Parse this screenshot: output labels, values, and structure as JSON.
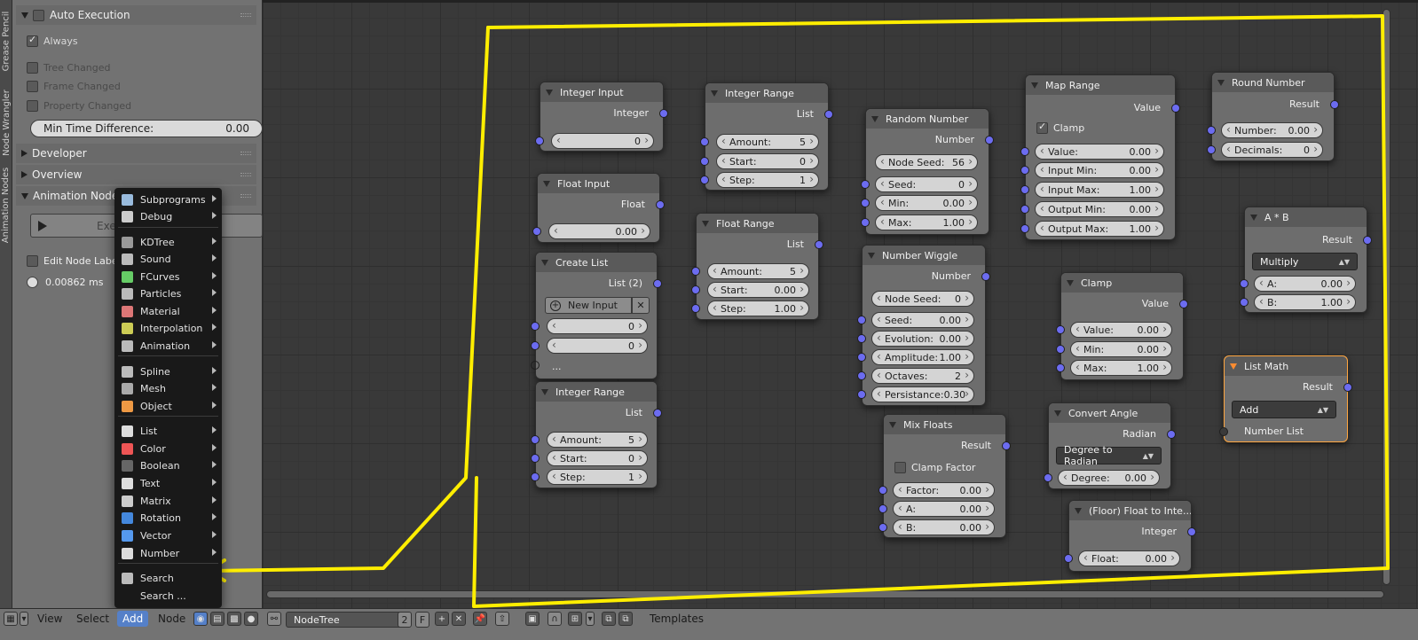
{
  "vertical_tabs": [
    "Grease Pencil",
    "Node Wrangler",
    "Animation Nodes"
  ],
  "sidebar": {
    "auto_execution": {
      "title": "Auto Execution",
      "enabled": false
    },
    "always": {
      "label": "Always",
      "checked": true
    },
    "tree_changed": {
      "label": "Tree Changed",
      "checked": false
    },
    "frame_changed": {
      "label": "Frame Changed",
      "checked": false
    },
    "property_changed": {
      "label": "Property Changed",
      "checked": false
    },
    "min_time": {
      "label": "Min Time Difference:",
      "value": "0.00"
    },
    "developer": "Developer",
    "overview": "Overview",
    "animation_node_tree": "Animation Node T",
    "execute_label": "Execute Node Tree",
    "edit_node_labels": "Edit Node Labels",
    "execution_time": "0.00862 ms"
  },
  "menu": {
    "items": [
      {
        "label": "Subprograms",
        "icon": "subprograms-icon",
        "submenu": true
      },
      {
        "label": "Debug",
        "icon": "debug-icon",
        "submenu": true
      },
      {
        "label": "KDTree",
        "icon": "kdtree-icon",
        "submenu": true
      },
      {
        "label": "Sound",
        "icon": "sound-icon",
        "submenu": true
      },
      {
        "label": "FCurves",
        "icon": "fcurves-icon",
        "submenu": true
      },
      {
        "label": "Particles",
        "icon": "particles-icon",
        "submenu": true
      },
      {
        "label": "Material",
        "icon": "material-icon",
        "submenu": true
      },
      {
        "label": "Interpolation",
        "icon": "interpolation-icon",
        "submenu": true
      },
      {
        "label": "Animation",
        "icon": "animation-icon",
        "submenu": true
      },
      {
        "label": "Spline",
        "icon": "spline-icon",
        "submenu": true
      },
      {
        "label": "Mesh",
        "icon": "mesh-icon",
        "submenu": true
      },
      {
        "label": "Object",
        "icon": "object-icon",
        "submenu": true
      },
      {
        "label": "List",
        "icon": "list-icon",
        "submenu": true
      },
      {
        "label": "Color",
        "icon": "color-icon",
        "submenu": true
      },
      {
        "label": "Boolean",
        "icon": "boolean-icon",
        "submenu": true
      },
      {
        "label": "Text",
        "icon": "text-icon",
        "submenu": true
      },
      {
        "label": "Matrix",
        "icon": "matrix-icon",
        "submenu": true
      },
      {
        "label": "Rotation",
        "icon": "rotation-icon",
        "submenu": true
      },
      {
        "label": "Vector",
        "icon": "vector-icon",
        "submenu": true
      },
      {
        "label": "Number",
        "icon": "number-icon",
        "submenu": true
      },
      {
        "label": "Search",
        "icon": "search-icon",
        "submenu": false
      },
      {
        "label": "Search ...",
        "icon": "",
        "submenu": false
      }
    ]
  },
  "nodes": {
    "integer_input": {
      "title": "Integer Input",
      "out": "Integer",
      "value": "0"
    },
    "float_input": {
      "title": "Float Input",
      "out": "Float",
      "value": "0.00"
    },
    "create_list": {
      "title": "Create List",
      "out": "List (2)",
      "new_input": "New Input",
      "v1": "0",
      "v2": "0",
      "more": "..."
    },
    "integer_range_2": {
      "title": "Integer Range",
      "out": "List",
      "amount_label": "Amount:",
      "amount": "5",
      "start_label": "Start:",
      "start": "0",
      "step_label": "Step:",
      "step": "1"
    },
    "integer_range_1": {
      "title": "Integer Range",
      "out": "List",
      "amount_label": "Amount:",
      "amount": "5",
      "start_label": "Start:",
      "start": "0",
      "step_label": "Step:",
      "step": "1"
    },
    "float_range": {
      "title": "Float Range",
      "out": "List",
      "amount_label": "Amount:",
      "amount": "5",
      "start_label": "Start:",
      "start": "0.00",
      "step_label": "Step:",
      "step": "1.00"
    },
    "random_number": {
      "title": "Random Number",
      "out": "Number",
      "node_seed_label": "Node Seed:",
      "node_seed": "56",
      "seed_label": "Seed:",
      "seed": "0",
      "min_label": "Min:",
      "min": "0.00",
      "max_label": "Max:",
      "max": "1.00"
    },
    "number_wiggle": {
      "title": "Number Wiggle",
      "out": "Number",
      "node_seed_label": "Node Seed:",
      "node_seed": "0",
      "seed_label": "Seed:",
      "seed": "0.00",
      "evolution_label": "Evolution:",
      "evolution": "0.00",
      "amplitude_label": "Amplitude:",
      "amplitude": "1.00",
      "octaves_label": "Octaves:",
      "octaves": "2",
      "persistance_label": "Persistance:",
      "persistance": "0.30"
    },
    "mix_floats": {
      "title": "Mix Floats",
      "out": "Result",
      "clamp_label": "Clamp Factor",
      "factor_label": "Factor:",
      "factor": "0.00",
      "a_label": "A:",
      "a": "0.00",
      "b_label": "B:",
      "b": "0.00"
    },
    "map_range": {
      "title": "Map Range",
      "out": "Value",
      "clamp_label": "Clamp",
      "value_label": "Value:",
      "value": "0.00",
      "in_min_label": "Input Min:",
      "in_min": "0.00",
      "in_max_label": "Input Max:",
      "in_max": "1.00",
      "out_min_label": "Output Min:",
      "out_min": "0.00",
      "out_max_label": "Output Max:",
      "out_max": "1.00"
    },
    "clamp": {
      "title": "Clamp",
      "out": "Value",
      "value_label": "Value:",
      "value": "0.00",
      "min_label": "Min:",
      "min": "0.00",
      "max_label": "Max:",
      "max": "1.00"
    },
    "convert_angle": {
      "title": "Convert Angle",
      "out": "Radian",
      "mode": "Degree to Radian",
      "degree_label": "Degree:",
      "degree": "0.00"
    },
    "float_to_int": {
      "title": "(Floor) Float to Inte...",
      "out": "Integer",
      "float_label": "Float:",
      "float": "0.00"
    },
    "round_number": {
      "title": "Round Number",
      "out": "Result",
      "number_label": "Number:",
      "number": "0.00",
      "decimals_label": "Decimals:",
      "decimals": "0"
    },
    "a_times_b": {
      "title": "A * B",
      "out": "Result",
      "op": "Multiply",
      "a_label": "A:",
      "a": "0.00",
      "b_label": "B:",
      "b": "1.00"
    },
    "list_math": {
      "title": "List Math",
      "out": "Result",
      "op": "Add",
      "input": "Number List"
    }
  },
  "bottombar": {
    "view": "View",
    "select": "Select",
    "add": "Add",
    "node": "Node",
    "tree_name": "NodeTree",
    "users": "2",
    "fake_user": "F",
    "templates": "Templates"
  },
  "colors": {
    "annotation": "#ffee00",
    "socket": "#6c6cf0",
    "selected_node": "#ffa640"
  }
}
